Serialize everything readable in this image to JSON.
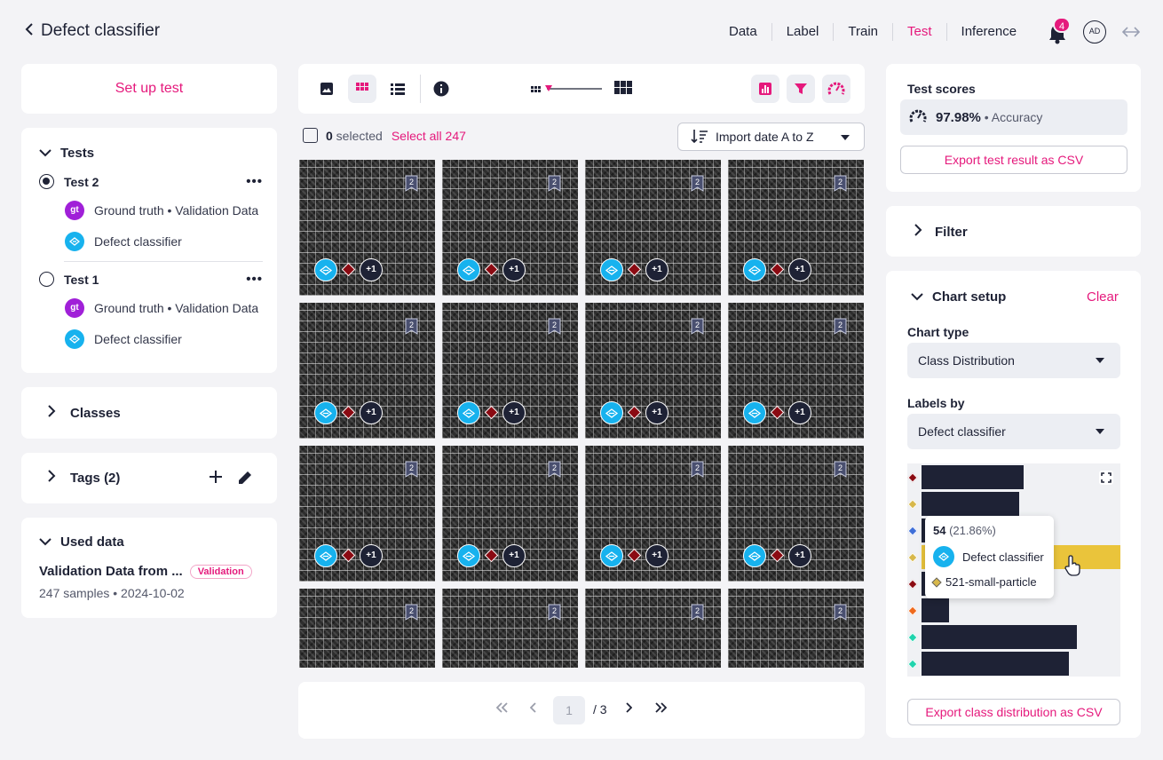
{
  "header": {
    "back_title": "Defect classifier",
    "nav": [
      "Data",
      "Label",
      "Train",
      "Test",
      "Inference"
    ],
    "active_nav": "Test",
    "notification_count": "4",
    "avatar_initials": "AD"
  },
  "left": {
    "setup_label": "Set up test",
    "tests_title": "Tests",
    "tests": [
      {
        "name": "Test 2",
        "selected": true,
        "ground_truth": "Ground truth • Validation Data",
        "model": "Defect classifier",
        "gt_badge": "gt"
      },
      {
        "name": "Test 1",
        "selected": false,
        "ground_truth": "Ground truth • Validation Data",
        "model": "Defect classifier",
        "gt_badge": "gt"
      }
    ],
    "more_label": "•••",
    "classes_title": "Classes",
    "tags_title": "Tags (2)",
    "used_data_title": "Used data",
    "dataset_name": "Validation Data from ...",
    "dataset_badge": "Validation",
    "dataset_meta": "247 samples • 2024-10-02"
  },
  "center": {
    "selected_count": "0",
    "selected_label": " selected",
    "select_all": "Select all 247",
    "sort_label": "Import date A to Z",
    "tile_bookmark": "2",
    "tile_more": "+1",
    "pager": {
      "current": "1",
      "total": "/ 3"
    }
  },
  "right": {
    "scores_title": "Test scores",
    "accuracy_value": "97.98%",
    "accuracy_label": " • Accuracy",
    "export_test": "Export test result as CSV",
    "filter_title": "Filter",
    "chart_setup_title": "Chart setup",
    "clear_label": "Clear",
    "chart_type_label": "Chart type",
    "chart_type_value": "Class Distribution",
    "labels_by_label": "Labels by",
    "labels_by_value": "Defect classifier",
    "export_dist": "Export class distribution as CSV",
    "tooltip": {
      "count": "54",
      "pct": " (21.86%)",
      "model": "Defect classifier",
      "class": "521-small-particle"
    }
  },
  "colors": {
    "accent": "#e5197c",
    "navy": "#1e2235",
    "highlight": "#eac43b",
    "model_blue": "#17b2ee"
  },
  "chart_data": {
    "type": "bar",
    "orientation": "horizontal",
    "marker_colors": [
      "#8b0a12",
      "#d8b84a",
      "#3f6fd8",
      "#d8b84a",
      "#8b0a12",
      "#ef6a1d",
      "#1fd4ad",
      "#1fd4ad"
    ],
    "values": [
      48,
      46,
      53,
      54,
      37,
      13,
      73,
      69
    ],
    "highlighted_index": 3,
    "xlim": [
      0,
      90
    ]
  }
}
